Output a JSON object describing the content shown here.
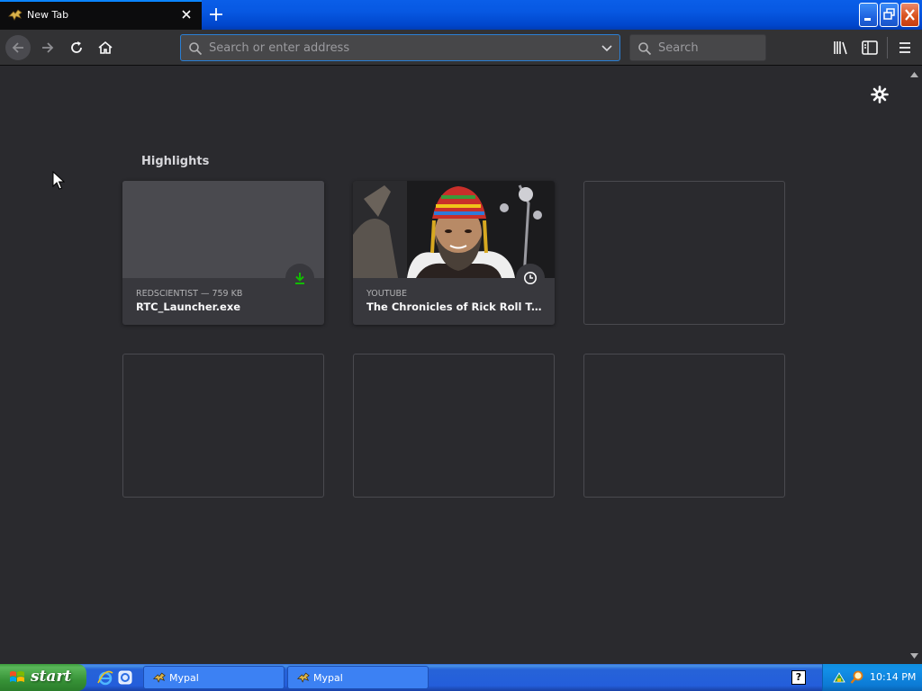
{
  "tab": {
    "title": "New Tab"
  },
  "toolbar": {
    "url_placeholder": "Search or enter address",
    "search_placeholder": "Search"
  },
  "highlights": {
    "title": "Highlights",
    "cards": [
      {
        "context": "REDSCIENTIST — 759 KB",
        "title": "RTC_Launcher.exe",
        "badge": "download-icon"
      },
      {
        "context": "YOUTUBE",
        "title": "The Chronicles of Rick Roll Trail...",
        "badge": "clock-icon"
      }
    ]
  },
  "taskbar": {
    "start_label": "start",
    "tasks": [
      {
        "label": "Mypal"
      },
      {
        "label": "Mypal"
      }
    ],
    "help_label": "?",
    "clock": "10:14 PM"
  },
  "colors": {
    "accent": "#0a84ff",
    "content_bg": "#2a2a2e",
    "download_green": "#12bc00"
  }
}
